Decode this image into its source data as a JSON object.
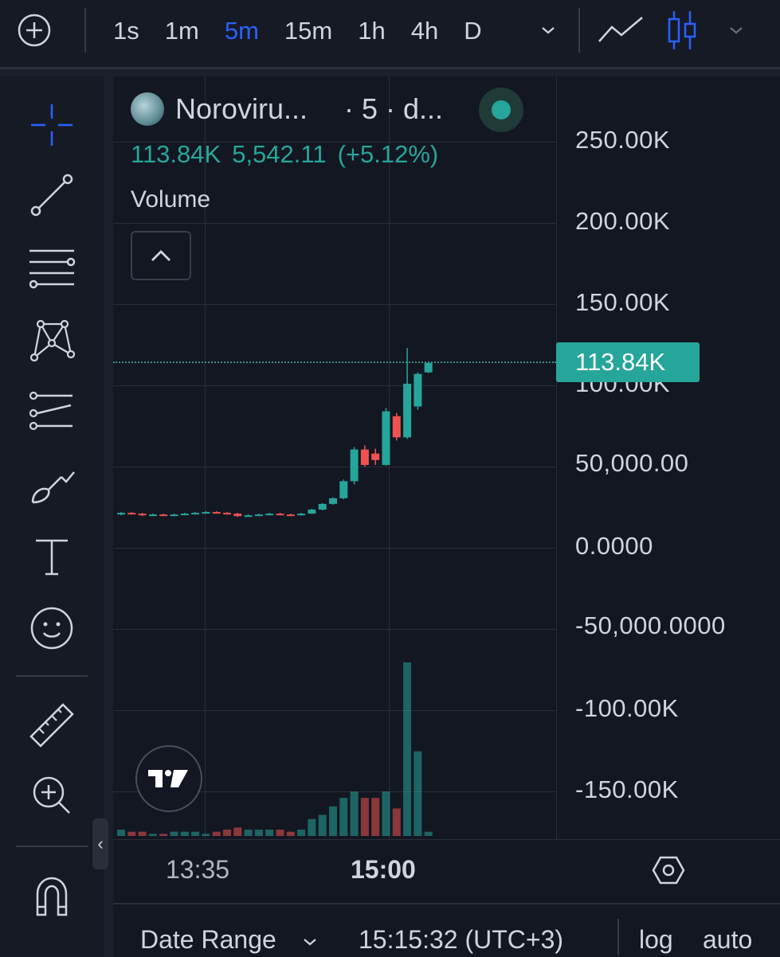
{
  "toolbar": {
    "add_icon": "plus-circle-icon",
    "intervals": [
      "1s",
      "1m",
      "5m",
      "15m",
      "1h",
      "4h",
      "D"
    ],
    "active_interval": "5m",
    "chart_types": [
      "line-chart-icon",
      "candlestick-icon"
    ],
    "active_color": "#2962ff"
  },
  "left_tools": [
    "crosshair-icon",
    "trend-line-icon",
    "fib-retracement-icon",
    "xabcd-pattern-icon",
    "forecast-icon",
    "brush-icon",
    "text-icon",
    "emoji-icon",
    "ruler-icon",
    "zoom-in-icon",
    "magnet-icon"
  ],
  "legend": {
    "symbol_name": "Noroviru...",
    "symbol_meta": "· 5 · d...",
    "last": "113.84K",
    "change": "5,542.11",
    "change_pct": "(+5.12%)",
    "volume_label": "Volume",
    "up_color": "#26a69a",
    "down_color": "#ef5350"
  },
  "price_axis": {
    "labels": [
      "250.00K",
      "200.00K",
      "150.00K",
      "100.00K",
      "50,000.00",
      "0.0000",
      "-50,000.0000",
      "-100.00K",
      "-150.00K"
    ],
    "last_price_tag": "113.84K"
  },
  "time_axis": {
    "labels": [
      "13:35",
      "15:00"
    ]
  },
  "bottom_bar": {
    "date_range": "Date Range",
    "clock": "15:15:32 (UTC+3)",
    "log": "log",
    "auto": "auto"
  },
  "chart_data": {
    "type": "candlestick",
    "interval": "5m",
    "ylim": [
      -150000,
      250000
    ],
    "candles": [
      {
        "o": 21000,
        "h": 22000,
        "l": 20000,
        "c": 21500
      },
      {
        "o": 21500,
        "h": 22000,
        "l": 20500,
        "c": 21000
      },
      {
        "o": 21000,
        "h": 21500,
        "l": 19500,
        "c": 20000
      },
      {
        "o": 20000,
        "h": 21000,
        "l": 19500,
        "c": 20500
      },
      {
        "o": 20500,
        "h": 21000,
        "l": 19800,
        "c": 20000
      },
      {
        "o": 20000,
        "h": 21000,
        "l": 19500,
        "c": 20500
      },
      {
        "o": 20500,
        "h": 21500,
        "l": 20000,
        "c": 21000
      },
      {
        "o": 21000,
        "h": 22000,
        "l": 20500,
        "c": 21500
      },
      {
        "o": 21500,
        "h": 22500,
        "l": 21000,
        "c": 22000
      },
      {
        "o": 22000,
        "h": 22500,
        "l": 21000,
        "c": 21500
      },
      {
        "o": 21500,
        "h": 22000,
        "l": 20500,
        "c": 21000
      },
      {
        "o": 21000,
        "h": 21500,
        "l": 19000,
        "c": 19500
      },
      {
        "o": 19500,
        "h": 20500,
        "l": 19000,
        "c": 20000
      },
      {
        "o": 20000,
        "h": 21000,
        "l": 19500,
        "c": 20500
      },
      {
        "o": 20500,
        "h": 21500,
        "l": 20000,
        "c": 21000
      },
      {
        "o": 21000,
        "h": 21500,
        "l": 20000,
        "c": 20500
      },
      {
        "o": 20500,
        "h": 21000,
        "l": 19500,
        "c": 20000
      },
      {
        "o": 20000,
        "h": 21500,
        "l": 19800,
        "c": 21000
      },
      {
        "o": 21000,
        "h": 24000,
        "l": 20800,
        "c": 23500
      },
      {
        "o": 23500,
        "h": 27500,
        "l": 23000,
        "c": 27000
      },
      {
        "o": 27000,
        "h": 31000,
        "l": 26500,
        "c": 30500
      },
      {
        "o": 30500,
        "h": 42000,
        "l": 30000,
        "c": 41000
      },
      {
        "o": 41000,
        "h": 62000,
        "l": 39000,
        "c": 60500
      },
      {
        "o": 60500,
        "h": 63000,
        "l": 50000,
        "c": 51000
      },
      {
        "o": 58000,
        "h": 61000,
        "l": 51000,
        "c": 54000
      },
      {
        "o": 51000,
        "h": 86000,
        "l": 50500,
        "c": 84000
      },
      {
        "o": 81000,
        "h": 83000,
        "l": 66000,
        "c": 68000
      },
      {
        "o": 68000,
        "h": 123000,
        "l": 67000,
        "c": 101000
      },
      {
        "o": 87000,
        "h": 108000,
        "l": 85000,
        "c": 107000
      },
      {
        "o": 108000,
        "h": 114500,
        "l": 107500,
        "c": 113840
      }
    ],
    "volume": [
      3,
      2,
      2,
      1,
      1,
      2,
      2,
      2,
      1,
      2,
      3,
      4,
      3,
      3,
      3,
      3,
      2,
      3,
      8,
      10,
      14,
      18,
      21,
      18,
      18,
      21,
      13,
      82,
      40,
      2
    ],
    "volume_scale": "relative"
  }
}
